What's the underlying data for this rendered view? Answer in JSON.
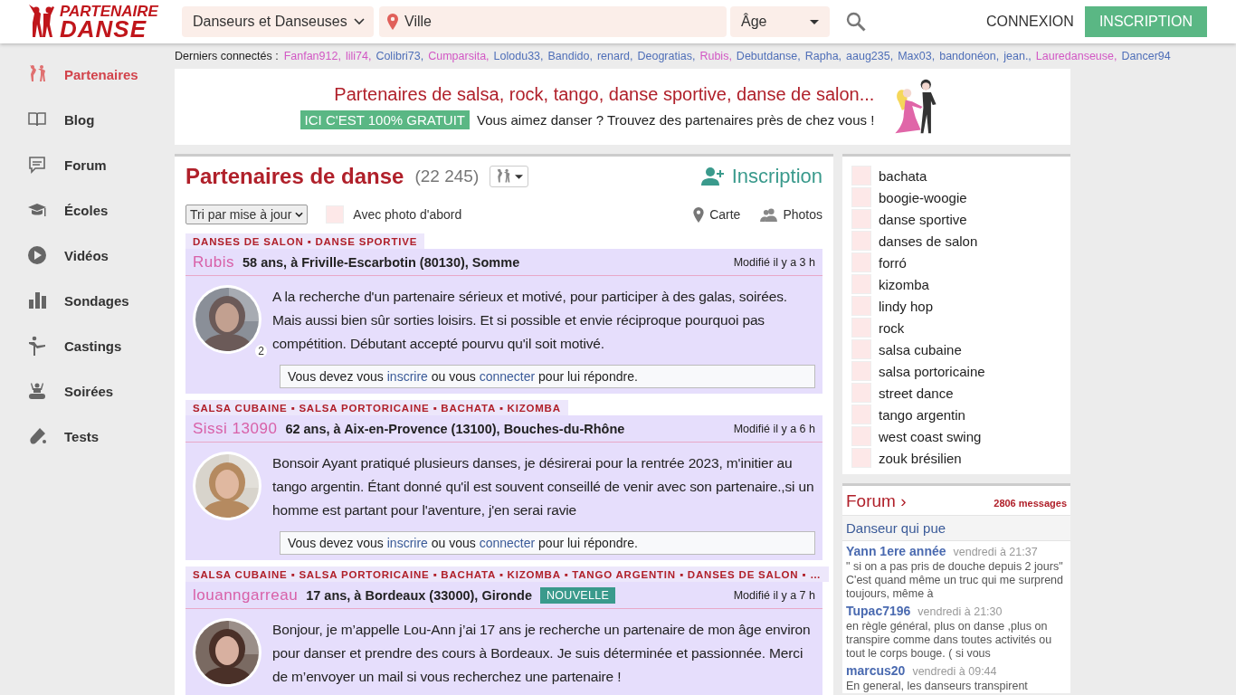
{
  "header": {
    "logo": {
      "line1": "PARTENAIRE",
      "line2": "DANSE"
    },
    "category": "Danseurs et Danseuses",
    "city_placeholder": "Ville",
    "age": "Âge",
    "login": "CONNEXION",
    "signup": "INSCRIPTION"
  },
  "sidebar": {
    "items": [
      {
        "label": "Partenaires",
        "selected": true
      },
      {
        "label": "Blog",
        "selected": false
      },
      {
        "label": "Forum",
        "selected": false
      },
      {
        "label": "Écoles",
        "selected": false
      },
      {
        "label": "Vidéos",
        "selected": false
      },
      {
        "label": "Sondages",
        "selected": false
      },
      {
        "label": "Castings",
        "selected": false
      },
      {
        "label": "Soirées",
        "selected": false
      },
      {
        "label": "Tests",
        "selected": false
      }
    ]
  },
  "recent": {
    "label": "Derniers connectés :",
    "users": [
      {
        "name": "Fanfan912,",
        "color": "#d257c4"
      },
      {
        "name": "lili74,",
        "color": "#d257c4"
      },
      {
        "name": "Colibri73,",
        "color": "#4f6fb8"
      },
      {
        "name": "Cumparsita,",
        "color": "#d257c4"
      },
      {
        "name": "Lolodu33,",
        "color": "#4f6fb8"
      },
      {
        "name": "Bandido,",
        "color": "#4f6fb8"
      },
      {
        "name": "renard,",
        "color": "#4f6fb8"
      },
      {
        "name": "Deogratias,",
        "color": "#4f6fb8"
      },
      {
        "name": "Rubis,",
        "color": "#d257c4"
      },
      {
        "name": "Debutdanse,",
        "color": "#4f6fb8"
      },
      {
        "name": "Rapha,",
        "color": "#4f6fb8"
      },
      {
        "name": "aaug235,",
        "color": "#4f6fb8"
      },
      {
        "name": "Max03,",
        "color": "#4f6fb8"
      },
      {
        "name": "bandonéon,",
        "color": "#4f6fb8"
      },
      {
        "name": "jean.,",
        "color": "#4f6fb8"
      },
      {
        "name": "Lauredanseuse,",
        "color": "#d257c4"
      },
      {
        "name": "Dancer94",
        "color": "#4f6fb8"
      }
    ]
  },
  "banner": {
    "headline": "Partenaires de salsa, rock, tango, danse sportive, danse de salon...",
    "badge": "ICI C'EST 100% GRATUIT",
    "tagline": "Vous aimez danser ? Trouvez des partenaires près de chez vous !"
  },
  "listing": {
    "title": "Partenaires de danse",
    "count": "(22 245)",
    "signup": "Inscription",
    "sort": "Tri par mise à jour",
    "photo_first": {
      "label": "Avec photo d'abord",
      "checked": false
    },
    "map": "Carte",
    "photos": "Photos",
    "posts": [
      {
        "tags": "DANSES DE SALON ▪ DANSE SPORTIVE",
        "name": "Rubis",
        "details": "58 ans, à Friville-Escarbotin (80130), Somme",
        "modified": "Modifié il y a 3 h",
        "photo_count": "2",
        "text": "A la recherche d'un partenaire sérieux et motivé, pour participer à des galas, soirées. Mais aussi bien sûr sorties loisirs. Et si possible et envie réciproque pourquoi pas compétition. Débutant accepté pourvu qu'il soit motivé.",
        "reply": {
          "before": "Vous devez vous",
          "link1": "inscrire",
          "middle": "ou vous",
          "link2": "connecter",
          "after": "pour lui répondre."
        }
      },
      {
        "tags": "SALSA CUBAINE ▪ SALSA PORTORICAINE ▪ BACHATA ▪ KIZOMBA",
        "name": "Sissi 13090",
        "details": "62 ans, à Aix-en-Provence (13100), Bouches-du-Rhône",
        "modified": "Modifié il y a 6 h",
        "text": "Bonsoir Ayant pratiqué plusieurs danses, je désirerai pour la rentrée 2023, m'initier au tango argentin. Étant donné qu'il est souvent conseillé de venir avec son partenaire.,si un homme est partant pour l'aventure, j'en serai ravie",
        "reply": {
          "before": "Vous devez vous",
          "link1": "inscrire",
          "middle": "ou vous",
          "link2": "connecter",
          "after": "pour lui répondre."
        }
      },
      {
        "tags": "SALSA CUBAINE ▪ SALSA PORTORICAINE ▪ BACHATA ▪ KIZOMBA ▪ TANGO ARGENTIN ▪ DANSES DE SALON ▪ …",
        "name": "louanngarreau",
        "details": "17 ans, à Bordeaux (33000), Gironde",
        "new_badge": "NOUVELLE",
        "modified": "Modifié il y a 7 h",
        "text": "Bonjour, je m’appelle Lou-Ann j’ai 17 ans je recherche un partenaire de mon âge environ pour danser et prendre des cours à Bordeaux. Je suis déterminée et passionnée. Merci de m’envoyer un mail si vous recherchez une partenaire !"
      }
    ]
  },
  "dances": [
    {
      "label": "bachata",
      "checked": false
    },
    {
      "label": "boogie-woogie",
      "checked": false
    },
    {
      "label": "danse sportive",
      "checked": false
    },
    {
      "label": "danses de salon",
      "checked": false
    },
    {
      "label": "forró",
      "checked": false
    },
    {
      "label": "kizomba",
      "checked": false
    },
    {
      "label": "lindy hop",
      "checked": false
    },
    {
      "label": "rock",
      "checked": false
    },
    {
      "label": "salsa cubaine",
      "checked": false
    },
    {
      "label": "salsa portoricaine",
      "checked": false
    },
    {
      "label": "street dance",
      "checked": false
    },
    {
      "label": "tango argentin",
      "checked": false
    },
    {
      "label": "west coast swing",
      "checked": false
    },
    {
      "label": "zouk brésilien",
      "checked": false
    }
  ],
  "forum": {
    "title": "Forum ›",
    "count": "2806 messages",
    "topic": "Danseur qui pue",
    "entries": [
      {
        "author": "Yann 1ere année",
        "time": "vendredi à 21:37",
        "text": "\" si on a pas pris de douche depuis 2 jours\" C'est quand même un truc qui me surprend toujours, même à"
      },
      {
        "author": "Tupac7196",
        "time": "vendredi à 21:30",
        "text": "en règle général, plus on danse ,plus on transpire comme dans toutes activités ou tout le corps bouge. ( si vous"
      },
      {
        "author": "marcus20",
        "time": "vendredi à 09:44",
        "text": "En general, les danseurs transpirent"
      }
    ]
  }
}
